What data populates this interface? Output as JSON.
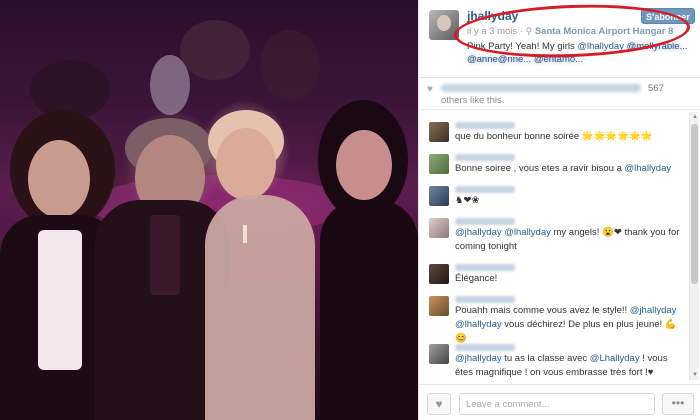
{
  "post": {
    "username": "jhallyday",
    "time_ago": "il y a 3 mois",
    "location": "Santa Monica Airport Hangar 8",
    "follow_label": "S'abonner",
    "caption_start": "Pink Party! Yeah! My girls ",
    "caption_mention1": "@lhallyday",
    "caption_mention2": "@mollyrable...",
    "caption_blurred": "@anne@nne... @entamo...",
    "red_annotation_color": "#d41e27"
  },
  "likes": {
    "count": "567",
    "text": "others like this."
  },
  "comments": [
    {
      "text": "que du bonheur bonne soirée 🌟🌟🌟🌟🌟🌟"
    },
    {
      "text": "Bonne soiree , vous etes a ravir bisou a ",
      "mention": "@lhallyday"
    },
    {
      "text": "♞❤❀"
    },
    {
      "mention": "@jhallyday",
      "mention2": "@lhallyday",
      "text": " my angels! 😮❤ thank you for coming tonight"
    },
    {
      "text": "Élégance!"
    },
    {
      "text": "Pouahh mais comme vous avez le style!! ",
      "mention": "@jhallyday",
      "mention2": "@lhallyday",
      "text2": " vous déchirez! De plus en plus jeune! 💪😊"
    },
    {
      "text": "",
      "mention": "@jhallyday",
      "text2": " tu as la classe avec ",
      "mention2": "@Lhallyday",
      "text3": " ! vous êtes magnifique ! on vous embrasse très fort !♥"
    }
  ],
  "footer": {
    "placeholder": "Leave a comment...",
    "more_label": "•••",
    "heart_icon": "♥"
  },
  "colors": {
    "link": "#2a5d8a",
    "follow_button": "#6f97be",
    "annotation": "#d41e27"
  }
}
